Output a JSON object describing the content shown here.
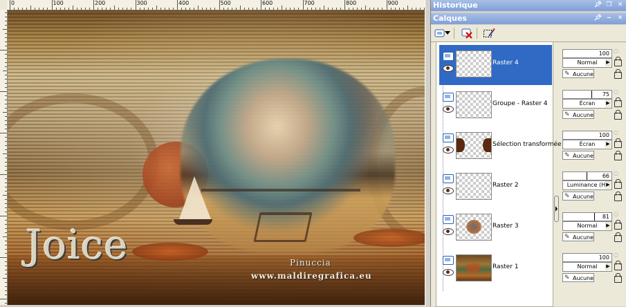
{
  "ruler": {
    "labels": [
      "0",
      "100",
      "200",
      "300",
      "400",
      "500",
      "600",
      "700",
      "800",
      "900"
    ]
  },
  "canvas": {
    "signature_text": "Joice",
    "credit_name": "Pinuccia",
    "credit_url": "www.maldiregrafica.eu"
  },
  "panels": {
    "history_title": "Historique",
    "layers_title": "Calques"
  },
  "toolbar": {
    "icons": [
      "new-layer-icon",
      "dropdown-arrow-icon",
      "delete-layer-icon",
      "mask-edit-icon"
    ]
  },
  "layers": [
    {
      "name": "Raster 4",
      "opacity": "100",
      "blend": "Normal",
      "mask": "Aucune",
      "selected": true,
      "opacity_pct": 100
    },
    {
      "name": "Groupe - Raster 4",
      "opacity": "75",
      "blend": "Écran",
      "mask": "Aucune",
      "selected": false,
      "opacity_pct": 75
    },
    {
      "name": "Sélection transformée",
      "opacity": "100",
      "blend": "Écran",
      "mask": "Aucune",
      "selected": false,
      "opacity_pct": 100
    },
    {
      "name": "Raster 2",
      "opacity": "66",
      "blend": "Luminance (H)",
      "mask": "Aucune",
      "selected": false,
      "opacity_pct": 66
    },
    {
      "name": "Raster 3",
      "opacity": "81",
      "blend": "Normal",
      "mask": "Aucune",
      "selected": false,
      "opacity_pct": 81
    },
    {
      "name": "Raster 1",
      "opacity": "100",
      "blend": "Normal",
      "mask": "Aucune",
      "selected": false,
      "opacity_pct": 100
    }
  ],
  "colors": {
    "panel_header": "#7f9fd7",
    "selection": "#316ac5",
    "panel_bg": "#ece9d8"
  }
}
